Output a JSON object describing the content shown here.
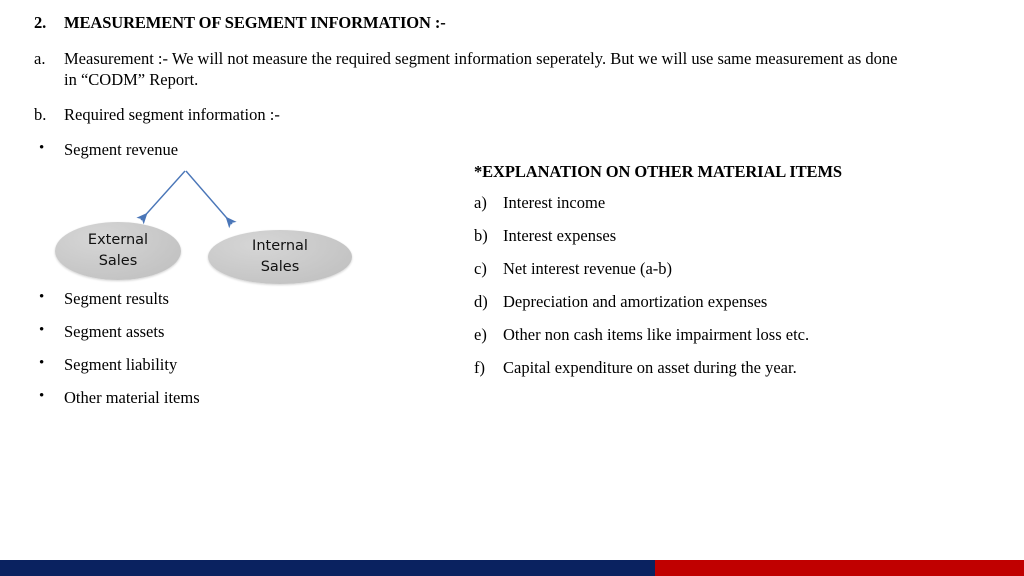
{
  "slide": {
    "heading": {
      "marker": "2.",
      "text": "MEASUREMENT OF SEGMENT INFORMATION :-"
    },
    "left_column": {
      "items": [
        {
          "marker": "a.",
          "text": "Measurement :-  We will not measure the required segment information seperately. But we will use same measurement as done in “CODM” Report."
        },
        {
          "marker": "b.",
          "text": "Required segment information :-"
        }
      ],
      "bullet_marker": "•",
      "first_bullet": "Segment revenue",
      "bullets_below_diagram": [
        "Segment results",
        "Segment assets",
        "Segment liability",
        "Other material items"
      ]
    },
    "diagram": {
      "nodes": [
        {
          "id": "external",
          "line1": "External",
          "line2": "Sales"
        },
        {
          "id": "internal",
          "line1": "Internal",
          "line2": "Sales"
        }
      ],
      "arrow_color": "#4a76b8",
      "node_fill": "#c8c8c8"
    },
    "right_column": {
      "title": "*EXPLANATION ON OTHER MATERIAL ITEMS",
      "items": [
        {
          "marker": "a)",
          "text": "Interest income"
        },
        {
          "marker": "b)",
          "text": "Interest expenses"
        },
        {
          "marker": "c)",
          "text": "Net interest revenue (a-b)"
        },
        {
          "marker": "d)",
          "text": "Depreciation and amortization expenses"
        },
        {
          "marker": "e)",
          "text": "Other non cash items like impairment loss etc."
        },
        {
          "marker": "f)",
          "text": "Capital expenditure on asset during the year."
        }
      ]
    },
    "footer": {
      "blue_color": "#0a2260",
      "red_color": "#c00000"
    }
  }
}
